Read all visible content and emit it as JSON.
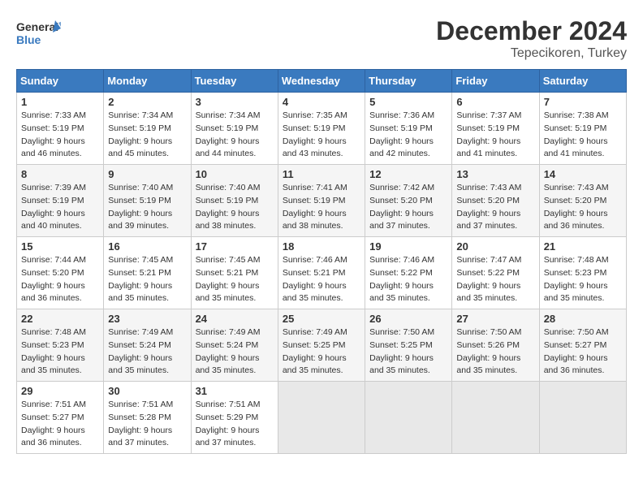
{
  "header": {
    "logo_general": "General",
    "logo_blue": "Blue",
    "title": "December 2024",
    "location": "Tepecikoren, Turkey"
  },
  "columns": [
    "Sunday",
    "Monday",
    "Tuesday",
    "Wednesday",
    "Thursday",
    "Friday",
    "Saturday"
  ],
  "weeks": [
    [
      {
        "day": "1",
        "info": "Sunrise: 7:33 AM\nSunset: 5:19 PM\nDaylight: 9 hours\nand 46 minutes."
      },
      {
        "day": "2",
        "info": "Sunrise: 7:34 AM\nSunset: 5:19 PM\nDaylight: 9 hours\nand 45 minutes."
      },
      {
        "day": "3",
        "info": "Sunrise: 7:34 AM\nSunset: 5:19 PM\nDaylight: 9 hours\nand 44 minutes."
      },
      {
        "day": "4",
        "info": "Sunrise: 7:35 AM\nSunset: 5:19 PM\nDaylight: 9 hours\nand 43 minutes."
      },
      {
        "day": "5",
        "info": "Sunrise: 7:36 AM\nSunset: 5:19 PM\nDaylight: 9 hours\nand 42 minutes."
      },
      {
        "day": "6",
        "info": "Sunrise: 7:37 AM\nSunset: 5:19 PM\nDaylight: 9 hours\nand 41 minutes."
      },
      {
        "day": "7",
        "info": "Sunrise: 7:38 AM\nSunset: 5:19 PM\nDaylight: 9 hours\nand 41 minutes."
      }
    ],
    [
      {
        "day": "8",
        "info": "Sunrise: 7:39 AM\nSunset: 5:19 PM\nDaylight: 9 hours\nand 40 minutes."
      },
      {
        "day": "9",
        "info": "Sunrise: 7:40 AM\nSunset: 5:19 PM\nDaylight: 9 hours\nand 39 minutes."
      },
      {
        "day": "10",
        "info": "Sunrise: 7:40 AM\nSunset: 5:19 PM\nDaylight: 9 hours\nand 38 minutes."
      },
      {
        "day": "11",
        "info": "Sunrise: 7:41 AM\nSunset: 5:19 PM\nDaylight: 9 hours\nand 38 minutes."
      },
      {
        "day": "12",
        "info": "Sunrise: 7:42 AM\nSunset: 5:20 PM\nDaylight: 9 hours\nand 37 minutes."
      },
      {
        "day": "13",
        "info": "Sunrise: 7:43 AM\nSunset: 5:20 PM\nDaylight: 9 hours\nand 37 minutes."
      },
      {
        "day": "14",
        "info": "Sunrise: 7:43 AM\nSunset: 5:20 PM\nDaylight: 9 hours\nand 36 minutes."
      }
    ],
    [
      {
        "day": "15",
        "info": "Sunrise: 7:44 AM\nSunset: 5:20 PM\nDaylight: 9 hours\nand 36 minutes."
      },
      {
        "day": "16",
        "info": "Sunrise: 7:45 AM\nSunset: 5:21 PM\nDaylight: 9 hours\nand 35 minutes."
      },
      {
        "day": "17",
        "info": "Sunrise: 7:45 AM\nSunset: 5:21 PM\nDaylight: 9 hours\nand 35 minutes."
      },
      {
        "day": "18",
        "info": "Sunrise: 7:46 AM\nSunset: 5:21 PM\nDaylight: 9 hours\nand 35 minutes."
      },
      {
        "day": "19",
        "info": "Sunrise: 7:46 AM\nSunset: 5:22 PM\nDaylight: 9 hours\nand 35 minutes."
      },
      {
        "day": "20",
        "info": "Sunrise: 7:47 AM\nSunset: 5:22 PM\nDaylight: 9 hours\nand 35 minutes."
      },
      {
        "day": "21",
        "info": "Sunrise: 7:48 AM\nSunset: 5:23 PM\nDaylight: 9 hours\nand 35 minutes."
      }
    ],
    [
      {
        "day": "22",
        "info": "Sunrise: 7:48 AM\nSunset: 5:23 PM\nDaylight: 9 hours\nand 35 minutes."
      },
      {
        "day": "23",
        "info": "Sunrise: 7:49 AM\nSunset: 5:24 PM\nDaylight: 9 hours\nand 35 minutes."
      },
      {
        "day": "24",
        "info": "Sunrise: 7:49 AM\nSunset: 5:24 PM\nDaylight: 9 hours\nand 35 minutes."
      },
      {
        "day": "25",
        "info": "Sunrise: 7:49 AM\nSunset: 5:25 PM\nDaylight: 9 hours\nand 35 minutes."
      },
      {
        "day": "26",
        "info": "Sunrise: 7:50 AM\nSunset: 5:25 PM\nDaylight: 9 hours\nand 35 minutes."
      },
      {
        "day": "27",
        "info": "Sunrise: 7:50 AM\nSunset: 5:26 PM\nDaylight: 9 hours\nand 35 minutes."
      },
      {
        "day": "28",
        "info": "Sunrise: 7:50 AM\nSunset: 5:27 PM\nDaylight: 9 hours\nand 36 minutes."
      }
    ],
    [
      {
        "day": "29",
        "info": "Sunrise: 7:51 AM\nSunset: 5:27 PM\nDaylight: 9 hours\nand 36 minutes."
      },
      {
        "day": "30",
        "info": "Sunrise: 7:51 AM\nSunset: 5:28 PM\nDaylight: 9 hours\nand 37 minutes."
      },
      {
        "day": "31",
        "info": "Sunrise: 7:51 AM\nSunset: 5:29 PM\nDaylight: 9 hours\nand 37 minutes."
      },
      {
        "day": "",
        "info": ""
      },
      {
        "day": "",
        "info": ""
      },
      {
        "day": "",
        "info": ""
      },
      {
        "day": "",
        "info": ""
      }
    ]
  ]
}
